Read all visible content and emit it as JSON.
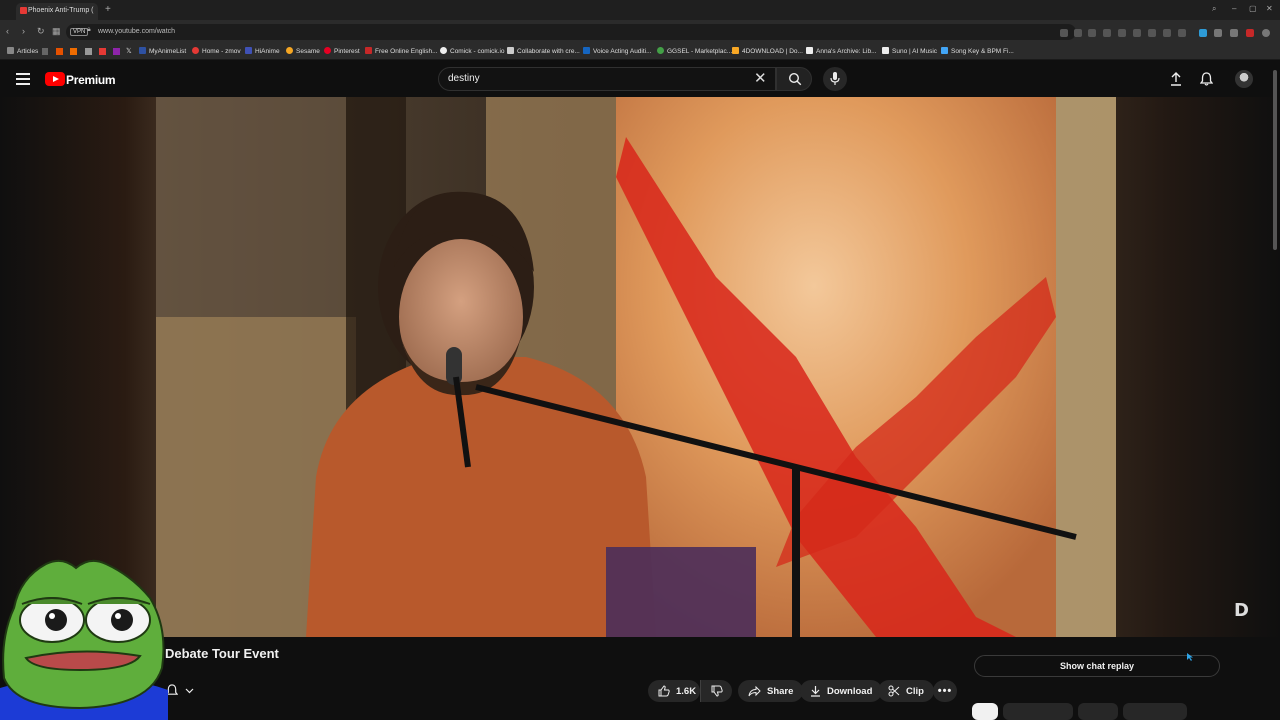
{
  "browser": {
    "tab_title": "Phoenix Anti-Trump (",
    "url": "www.youtube.com/watch",
    "vpn_badge": "VPN",
    "bookmarks": [
      {
        "label": "Articles",
        "color": "#888888"
      },
      {
        "label": "MyAnimeList",
        "color": "#2e51a2"
      },
      {
        "label": "Home - zmov",
        "color": "#e53935"
      },
      {
        "label": "HiAnime",
        "color": "#3f51b5"
      },
      {
        "label": "Sesame",
        "color": "#f5a623"
      },
      {
        "label": "Pinterest",
        "color": "#e60023"
      },
      {
        "label": "Free Online English...",
        "color": "#c62828"
      },
      {
        "label": "Comick - comick.io",
        "color": "#eeeeee"
      },
      {
        "label": "Collaborate with cre...",
        "color": "#cccccc"
      },
      {
        "label": "Voice Acting Auditi...",
        "color": "#1565c0"
      },
      {
        "label": "GGSEL - Marketplac...",
        "color": "#43a047"
      },
      {
        "label": "4DOWNLOAD | Do...",
        "color": "#f9a825"
      },
      {
        "label": "Anna's Archive: Lib...",
        "color": "#eeeeee"
      },
      {
        "label": "Suno | AI Music",
        "color": "#eeeeee"
      },
      {
        "label": "Song Key & BPM Fi...",
        "color": "#42a5f5"
      }
    ]
  },
  "header": {
    "brand": "Premium",
    "search_query": "destiny"
  },
  "video": {
    "title": "Debate Tour Event",
    "likes": "1.6K",
    "share_label": "Share",
    "download_label": "Download",
    "clip_label": "Clip",
    "chat_replay_label": "Show chat replay"
  },
  "colors": {
    "brand_red": "#ff0000",
    "background": "#0f0f0f",
    "pill_bg": "#272727"
  }
}
